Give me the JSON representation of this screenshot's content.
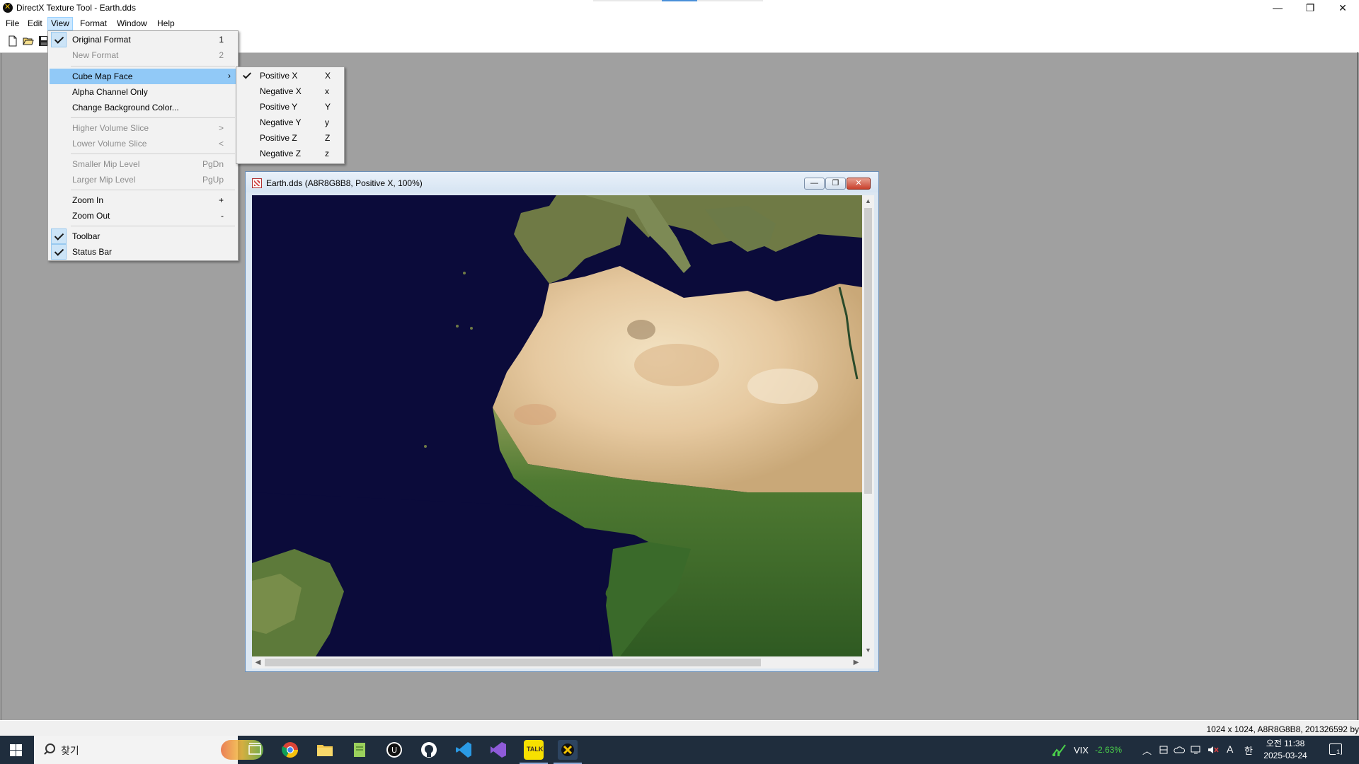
{
  "app": {
    "title": "DirectX Texture Tool - Earth.dds"
  },
  "window_controls": {
    "minimize": "—",
    "restore": "❐",
    "close": "✕"
  },
  "menubar": {
    "items": [
      "File",
      "Edit",
      "View",
      "Format",
      "Window",
      "Help"
    ]
  },
  "view_menu": {
    "items": [
      {
        "label": "Original Format",
        "shortcut": "1",
        "checked": true,
        "enabled": true
      },
      {
        "label": "New Format",
        "shortcut": "2",
        "checked": false,
        "enabled": false
      },
      {
        "label": "Cube Map Face",
        "shortcut": "›",
        "checked": false,
        "enabled": true,
        "highlighted": true
      },
      {
        "label": "Alpha Channel Only",
        "shortcut": "",
        "checked": false,
        "enabled": true
      },
      {
        "label": "Change Background Color...",
        "shortcut": "",
        "checked": false,
        "enabled": true
      },
      {
        "label": "Higher Volume Slice",
        "shortcut": ">",
        "checked": false,
        "enabled": false
      },
      {
        "label": "Lower Volume Slice",
        "shortcut": "<",
        "checked": false,
        "enabled": false
      },
      {
        "label": "Smaller Mip Level",
        "shortcut": "PgDn",
        "checked": false,
        "enabled": false
      },
      {
        "label": "Larger Mip Level",
        "shortcut": "PgUp",
        "checked": false,
        "enabled": false
      },
      {
        "label": "Zoom In",
        "shortcut": "+",
        "checked": false,
        "enabled": true
      },
      {
        "label": "Zoom Out",
        "shortcut": "-",
        "checked": false,
        "enabled": true
      },
      {
        "label": "Toolbar",
        "shortcut": "",
        "checked": true,
        "enabled": true
      },
      {
        "label": "Status Bar",
        "shortcut": "",
        "checked": true,
        "enabled": true
      }
    ]
  },
  "cube_face_submenu": {
    "items": [
      {
        "label": "Positive X",
        "shortcut": "X",
        "checked": true
      },
      {
        "label": "Negative X",
        "shortcut": "x",
        "checked": false
      },
      {
        "label": "Positive Y",
        "shortcut": "Y",
        "checked": false
      },
      {
        "label": "Negative Y",
        "shortcut": "y",
        "checked": false
      },
      {
        "label": "Positive Z",
        "shortcut": "Z",
        "checked": false
      },
      {
        "label": "Negative Z",
        "shortcut": "z",
        "checked": false
      }
    ]
  },
  "child_window": {
    "title": "Earth.dds (A8R8G8B8, Positive X, 100%)",
    "minimize": "—",
    "restore": "❐",
    "close": "✕",
    "image_icon": "earth-texture-image"
  },
  "statusbar": {
    "text": "1024 x 1024, A8R8G8B8, 201326592 by"
  },
  "taskbar": {
    "search_label": "찾기",
    "icons": [
      "task-view-icon",
      "chrome-icon",
      "file-explorer-icon",
      "notepad-icon",
      "unreal-engine-icon",
      "github-icon",
      "vscode-icon",
      "visual-studio-icon",
      "kakaotalk-icon",
      "directx-texture-tool-icon"
    ],
    "kakao_label": "TALK",
    "vix_label": "VIX",
    "vix_change": "-2.63%",
    "ime_label": "A",
    "ime2_label": "한",
    "clock_ampm_time": "오전 11:38",
    "clock_date": "2025-03-24",
    "notification_count": "1"
  },
  "colors": {
    "menu_highlight": "#91c9f7",
    "check_bg": "#cce4f7",
    "mdi_background": "#a0a0a0",
    "taskbar": "#1f2d3d",
    "ocean": "#0b0b3a",
    "vix_green": "#4ad04a"
  }
}
